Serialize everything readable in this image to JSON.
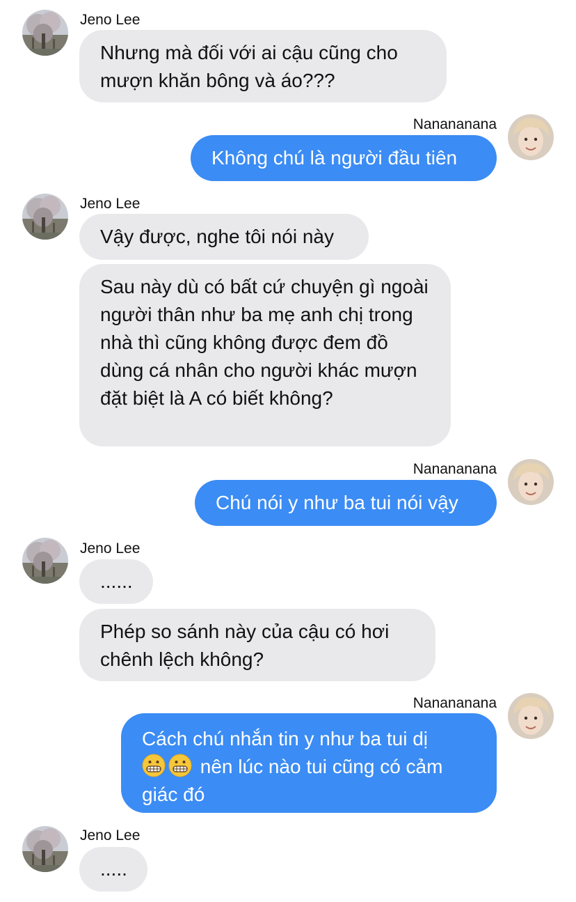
{
  "participants": {
    "other": "Jeno Lee",
    "self": "Nanananana"
  },
  "messages": [
    {
      "sender": "Jeno Lee",
      "text": "Nhưng mà đối với ai cậu cũng cho mượn khăn bông và áo???"
    },
    {
      "sender": "Nanananana",
      "text": "Không chú là người đầu tiên"
    },
    {
      "sender": "Jeno Lee",
      "text": "Vậy được, nghe tôi nói này"
    },
    {
      "sender": "Jeno Lee",
      "text": "Sau này dù có bất cứ chuyện gì ngoài người thân như ba mẹ anh chị trong nhà thì cũng không được đem đồ dùng cá nhân cho người khác mượn đặt biệt là A có biết không?"
    },
    {
      "sender": "Nanananana",
      "text": "Chú nói y như ba tui nói vậy"
    },
    {
      "sender": "Jeno Lee",
      "text": "......"
    },
    {
      "sender": "Jeno Lee",
      "text": "Phép so sánh này của cậu có hơi chênh lệch không?"
    },
    {
      "sender": "Nanananana",
      "text_line1": "Cách chú nhắn tin y như ba tui dị",
      "text_after_emoji": "nên lúc nào tui cũng có cảm giác đó",
      "emojis": [
        "grimacing-face",
        "grimacing-face"
      ]
    },
    {
      "sender": "Jeno Lee",
      "text": "....."
    }
  ],
  "colors": {
    "incoming_bubble": "#e9e9eb",
    "outgoing_bubble": "#3b8cf4",
    "outgoing_text": "#ffffff",
    "incoming_text": "#111111"
  }
}
